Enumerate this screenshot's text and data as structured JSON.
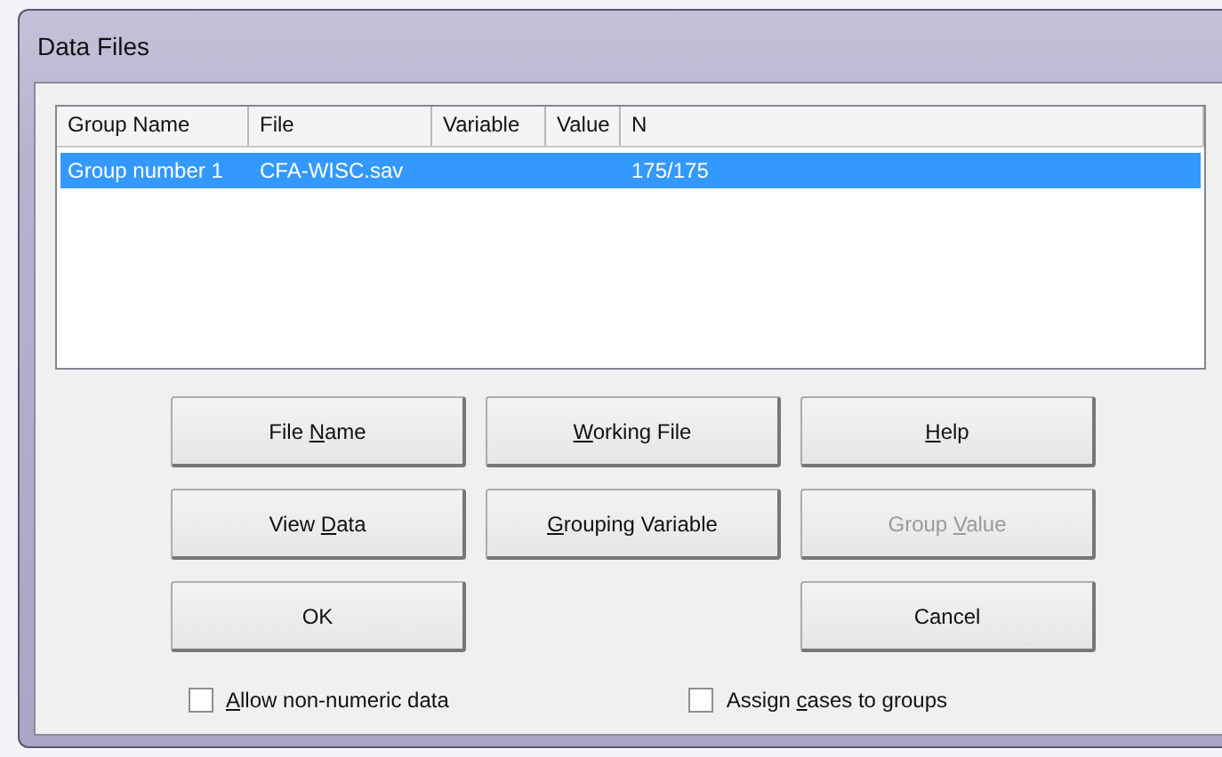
{
  "window": {
    "title": "Data Files"
  },
  "table": {
    "columns": [
      "Group Name",
      "File",
      "Variable",
      "Value",
      "N"
    ],
    "rows": [
      {
        "cells": [
          "Group number 1",
          "CFA-WISC.sav",
          "",
          "",
          "175/175"
        ],
        "selected": true
      }
    ]
  },
  "buttons": [
    {
      "label_before": "File ",
      "mnemonic": "N",
      "label_after": "ame",
      "disabled": false
    },
    {
      "mnemonic": "W",
      "label_after": "orking File",
      "disabled": false
    },
    {
      "mnemonic": "H",
      "label_after": "elp",
      "disabled": false
    },
    {
      "label_before": "View ",
      "mnemonic": "D",
      "label_after": "ata",
      "disabled": false
    },
    {
      "mnemonic": "G",
      "label_after": "rouping Variable",
      "disabled": false
    },
    {
      "label_before": "Group ",
      "mnemonic": "V",
      "label_after": "alue",
      "disabled": true
    },
    {
      "label_before": "OK",
      "disabled": false
    },
    {
      "label_before": "Cancel",
      "disabled": false
    }
  ],
  "checkboxes": [
    {
      "mnemonic": "A",
      "label_after": "llow non-numeric data",
      "checked": false
    },
    {
      "label_before": "Assign ",
      "mnemonic": "c",
      "label_after": "ases to groups",
      "checked": false
    }
  ]
}
